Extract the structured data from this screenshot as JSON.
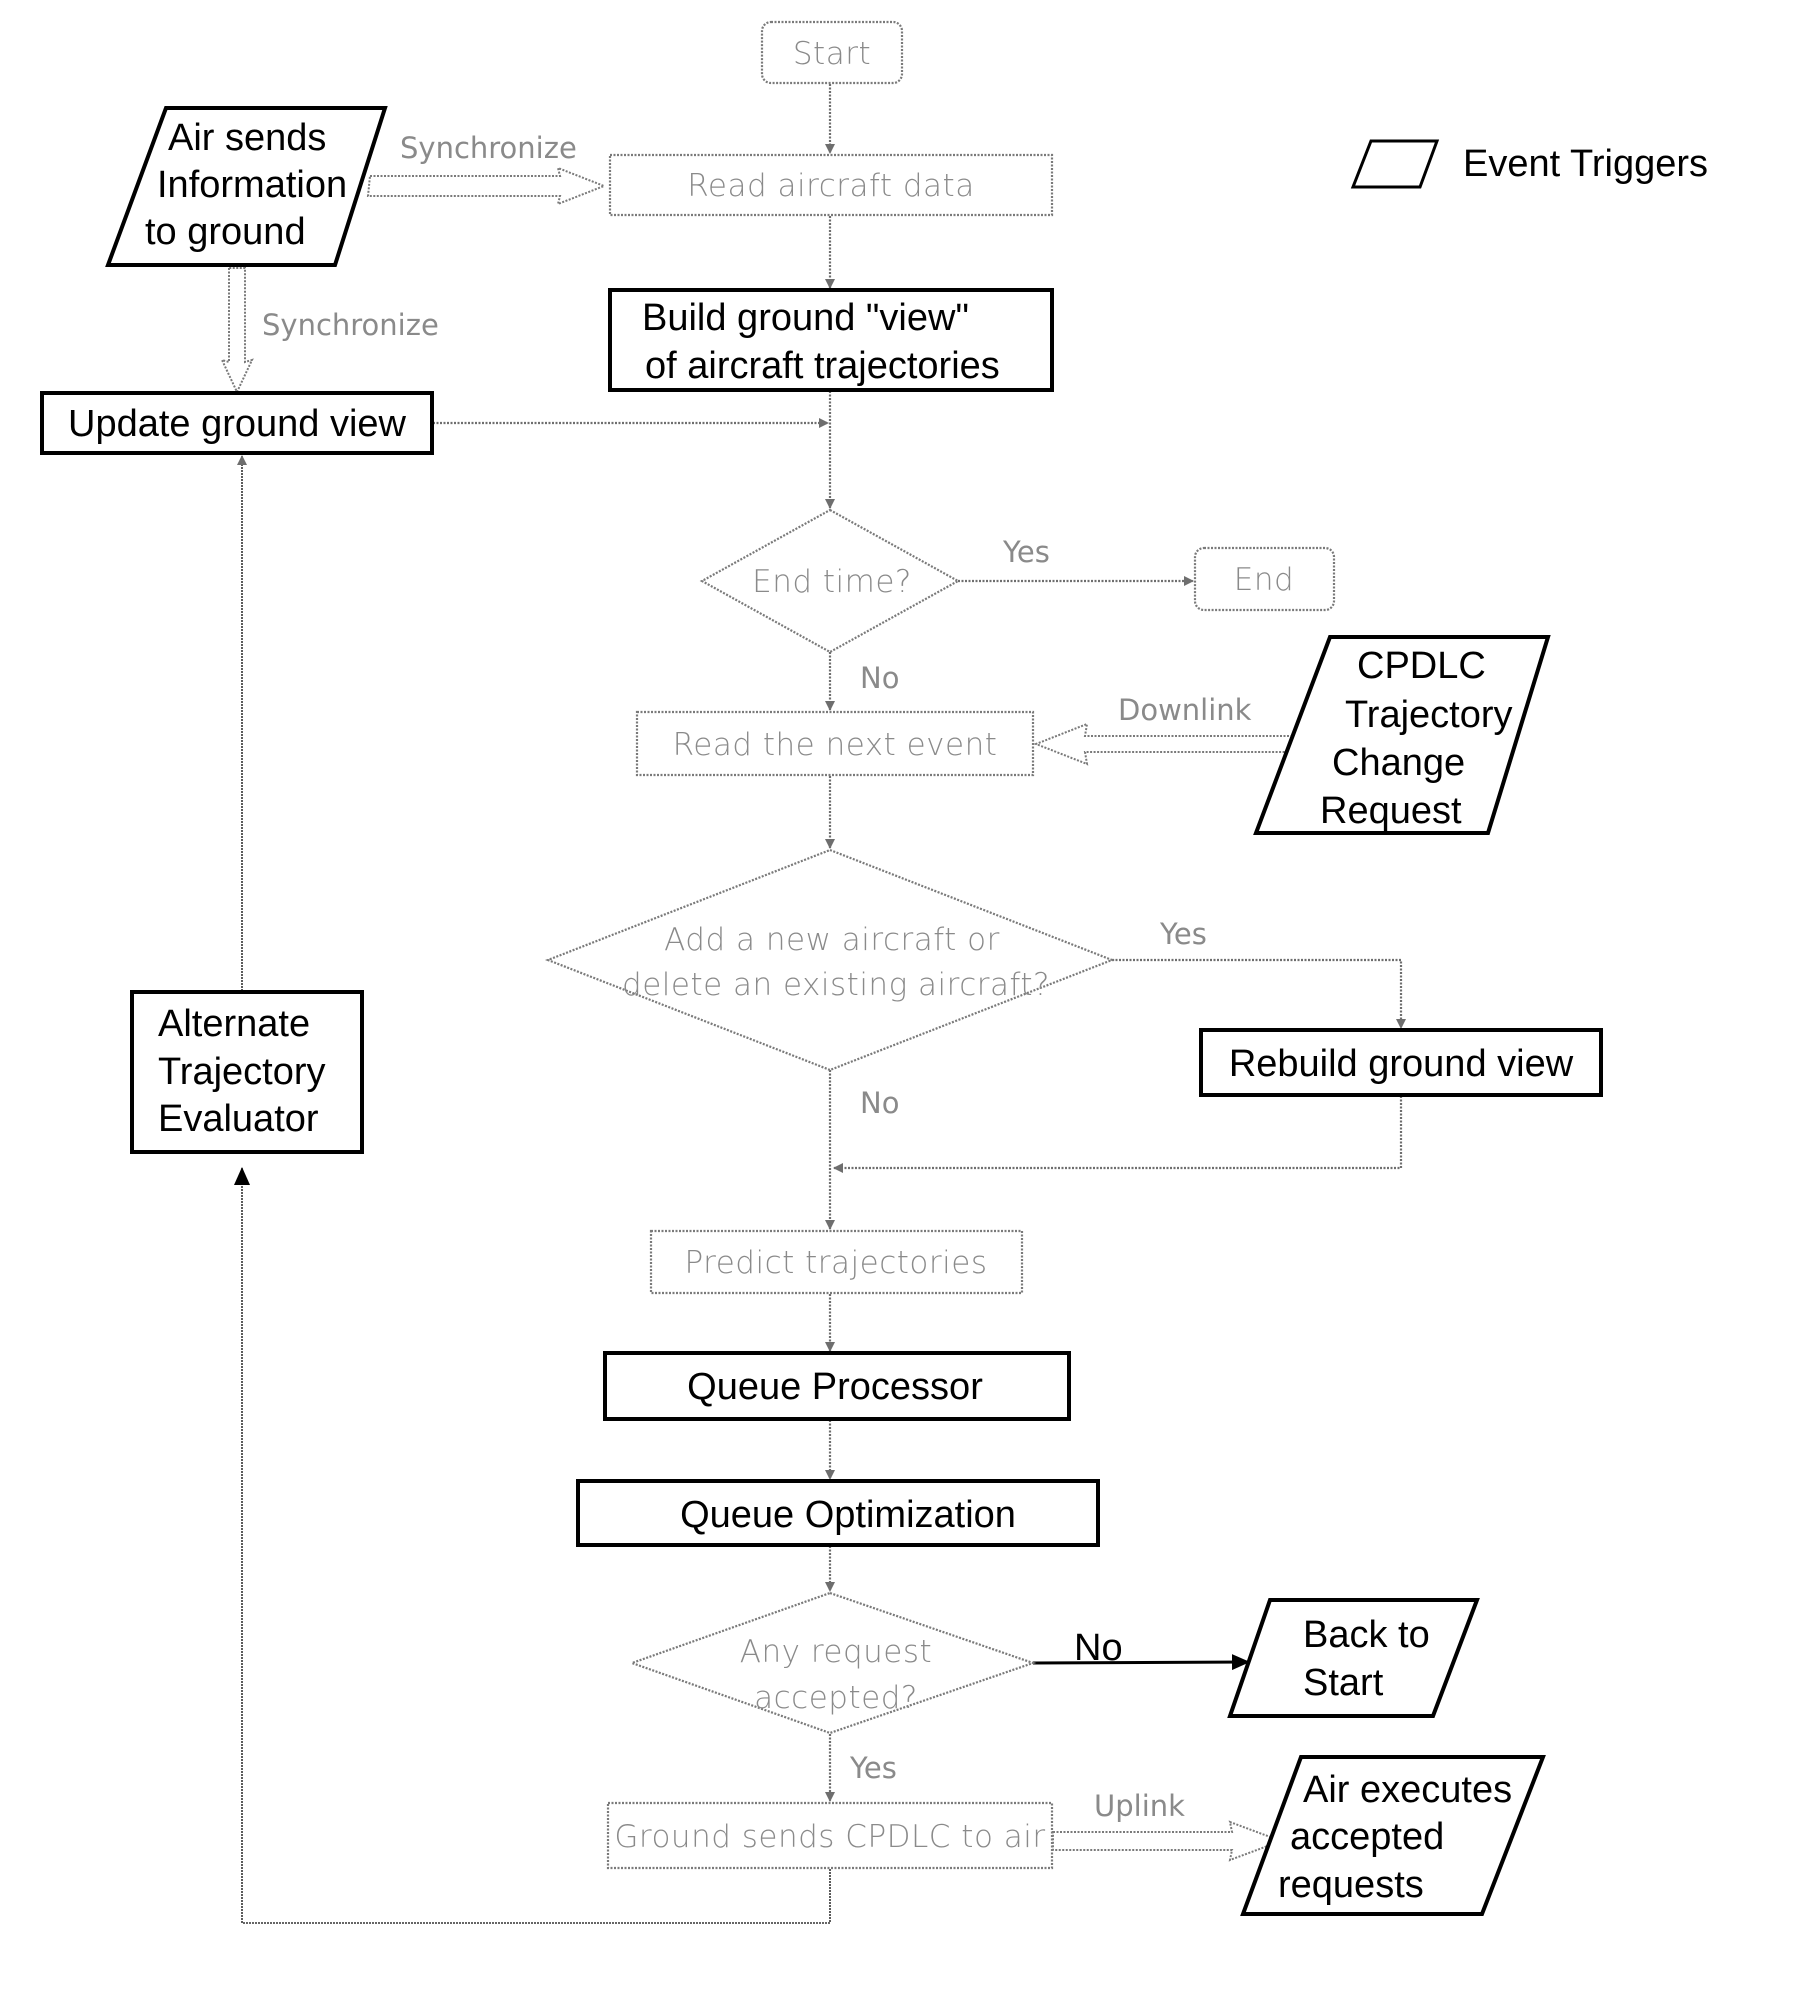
{
  "diagram": {
    "legend": {
      "label": "Event Triggers",
      "icon": "parallelogram-icon"
    },
    "nodes": {
      "start": "Start",
      "read_aircraft_data": "Read aircraft data",
      "build_ground_view": [
        "Build ground \"view\"",
        "of aircraft trajectories"
      ],
      "air_sends": [
        "Air sends",
        "Information",
        "to ground"
      ],
      "update_ground_view": "Update ground view",
      "end_time": "End time?",
      "end": "End",
      "read_next_event": "Read the next event",
      "cpdlc_request": [
        "CPDLC",
        "Trajectory",
        "Change",
        "Request"
      ],
      "add_delete": [
        "Add a new aircraft or",
        "delete an existing aircraft?"
      ],
      "rebuild_ground_view": "Rebuild ground view",
      "alternate_evaluator": [
        "Alternate",
        "Trajectory",
        "Evaluator"
      ],
      "predict_trajectories": "Predict trajectories",
      "queue_processor": "Queue Processor",
      "queue_optimization": "Queue Optimization",
      "any_request": [
        "Any request",
        "accepted?"
      ],
      "back_to_start": [
        "Back to",
        "Start"
      ],
      "ground_sends": "Ground sends CPDLC to air",
      "air_executes": [
        "Air executes",
        "accepted",
        "requests"
      ]
    },
    "edge_labels": {
      "sync_right": "Synchronize",
      "sync_down": "Synchronize",
      "end_yes": "Yes",
      "end_no": "No",
      "downlink": "Downlink",
      "add_yes": "Yes",
      "add_no": "No",
      "any_no": "No",
      "any_yes": "Yes",
      "uplink": "Uplink"
    }
  }
}
